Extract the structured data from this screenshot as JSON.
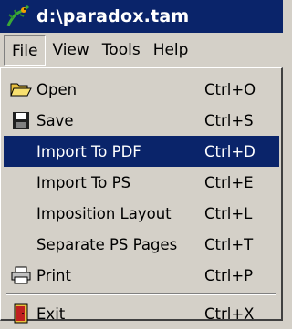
{
  "window": {
    "title": "d:\\paradox.tam",
    "icon": "frog-app-icon"
  },
  "menubar": {
    "items": [
      {
        "label": "File"
      },
      {
        "label": "View"
      },
      {
        "label": "Tools"
      },
      {
        "label": "Help"
      }
    ]
  },
  "file_menu": {
    "items": [
      {
        "label": "Open",
        "shortcut": "Ctrl+O",
        "icon": "open-folder-icon"
      },
      {
        "label": "Save",
        "shortcut": "Ctrl+S",
        "icon": "floppy-disk-icon"
      },
      {
        "label": "Import To PDF",
        "shortcut": "Ctrl+D",
        "highlighted": true
      },
      {
        "label": "Import To PS",
        "shortcut": "Ctrl+E"
      },
      {
        "label": "Imposition Layout",
        "shortcut": "Ctrl+L"
      },
      {
        "label": "Separate PS Pages",
        "shortcut": "Ctrl+T"
      },
      {
        "label": "Print",
        "shortcut": "Ctrl+P",
        "icon": "printer-icon"
      },
      {
        "label": "Exit",
        "shortcut": "Ctrl+X",
        "icon": "exit-door-icon"
      }
    ]
  },
  "colors": {
    "selection": "#0a246a",
    "face": "#d4d0c8"
  }
}
